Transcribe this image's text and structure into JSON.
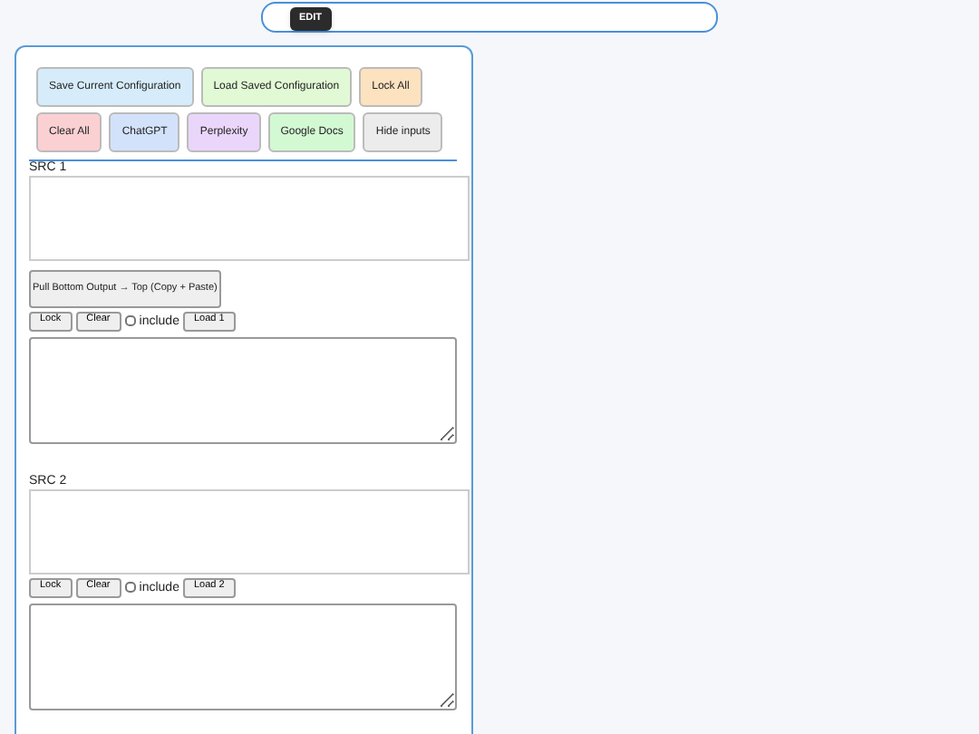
{
  "top_bar": {
    "badge": "EDIT"
  },
  "toolbar": [
    {
      "label": "Save Current Configuration",
      "color": "#d6ecfa"
    },
    {
      "label": "Load Saved Configuration",
      "color": "#e2f9d6"
    },
    {
      "label": "Lock All",
      "color": "#fde2c0"
    },
    {
      "label": "Clear All",
      "color": "#fbd0d3"
    },
    {
      "label": "ChatGPT",
      "color": "#d3e2fb"
    },
    {
      "label": "Perplexity",
      "color": "#ead6fb"
    },
    {
      "label": "Google Docs",
      "color": "#d3f9d3"
    },
    {
      "label": "Hide inputs",
      "color": "#ececec"
    }
  ],
  "sources": [
    {
      "label": "SRC 1",
      "pull_button": "Pull Bottom Output → Top (Copy + Paste)",
      "lock": "Lock",
      "clear": "Clear",
      "include": {
        "label": "include",
        "checked": false
      },
      "load": "Load 1"
    },
    {
      "label": "SRC 2",
      "lock": "Lock",
      "clear": "Clear",
      "include": {
        "label": "include",
        "checked": false
      },
      "load": "Load 2"
    }
  ]
}
